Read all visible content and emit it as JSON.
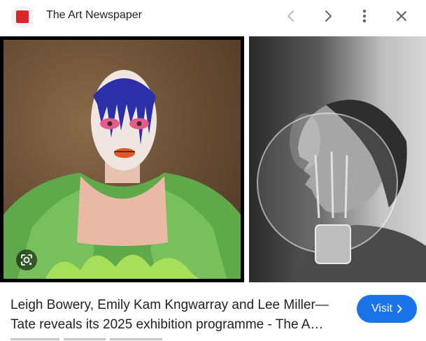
{
  "header": {
    "site_name": "The Art Newspaper",
    "favicon_color": "#e0242c",
    "icons": [
      "back-chevron-icon",
      "forward-chevron-icon",
      "more-vert-icon",
      "close-icon"
    ]
  },
  "images": [
    {
      "name": "leigh-bowery-portrait",
      "selected": true
    },
    {
      "name": "lee-miller-photograph",
      "selected": false
    }
  ],
  "result": {
    "title_line1": "Leigh Bowery, Emily Kam Kngwarray and Lee Miller—",
    "title_line2": "Tate reveals its 2025 exhibition programme - The A…"
  },
  "visit_button": {
    "label": "Visit",
    "color": "#1a73e8"
  }
}
